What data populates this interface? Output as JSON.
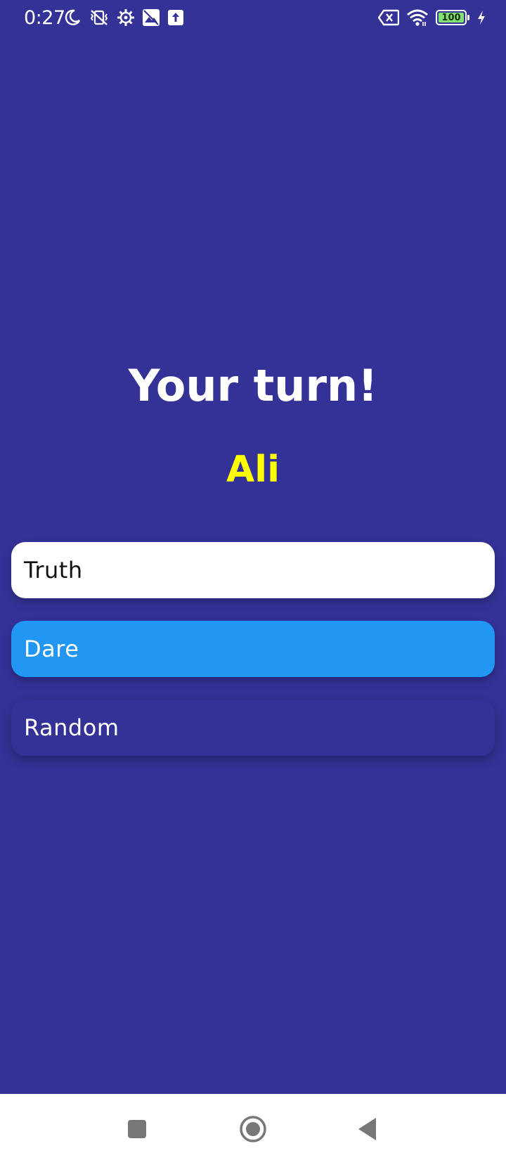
{
  "status_bar": {
    "time": "0:27",
    "battery_level": "100",
    "icons_left": [
      "moon-icon",
      "vibrate-off-icon",
      "settings-icon",
      "photo-icon",
      "upload-icon"
    ],
    "icons_right": [
      "no-sim-icon",
      "wifi-icon",
      "battery-icon",
      "charging-icon"
    ],
    "battery_color": "#7ee36f"
  },
  "game": {
    "title": "Your turn!",
    "player_name": "Ali",
    "player_color": "#ffff00",
    "options": [
      {
        "label": "Truth",
        "color": "#ffffff"
      },
      {
        "label": "Dare",
        "color": "#2196f3"
      },
      {
        "label": "Random",
        "color": "#343297"
      }
    ]
  },
  "nav_bar": {
    "buttons": [
      "recents-button",
      "home-button",
      "back-button"
    ]
  },
  "colors": {
    "background": "#343297"
  }
}
